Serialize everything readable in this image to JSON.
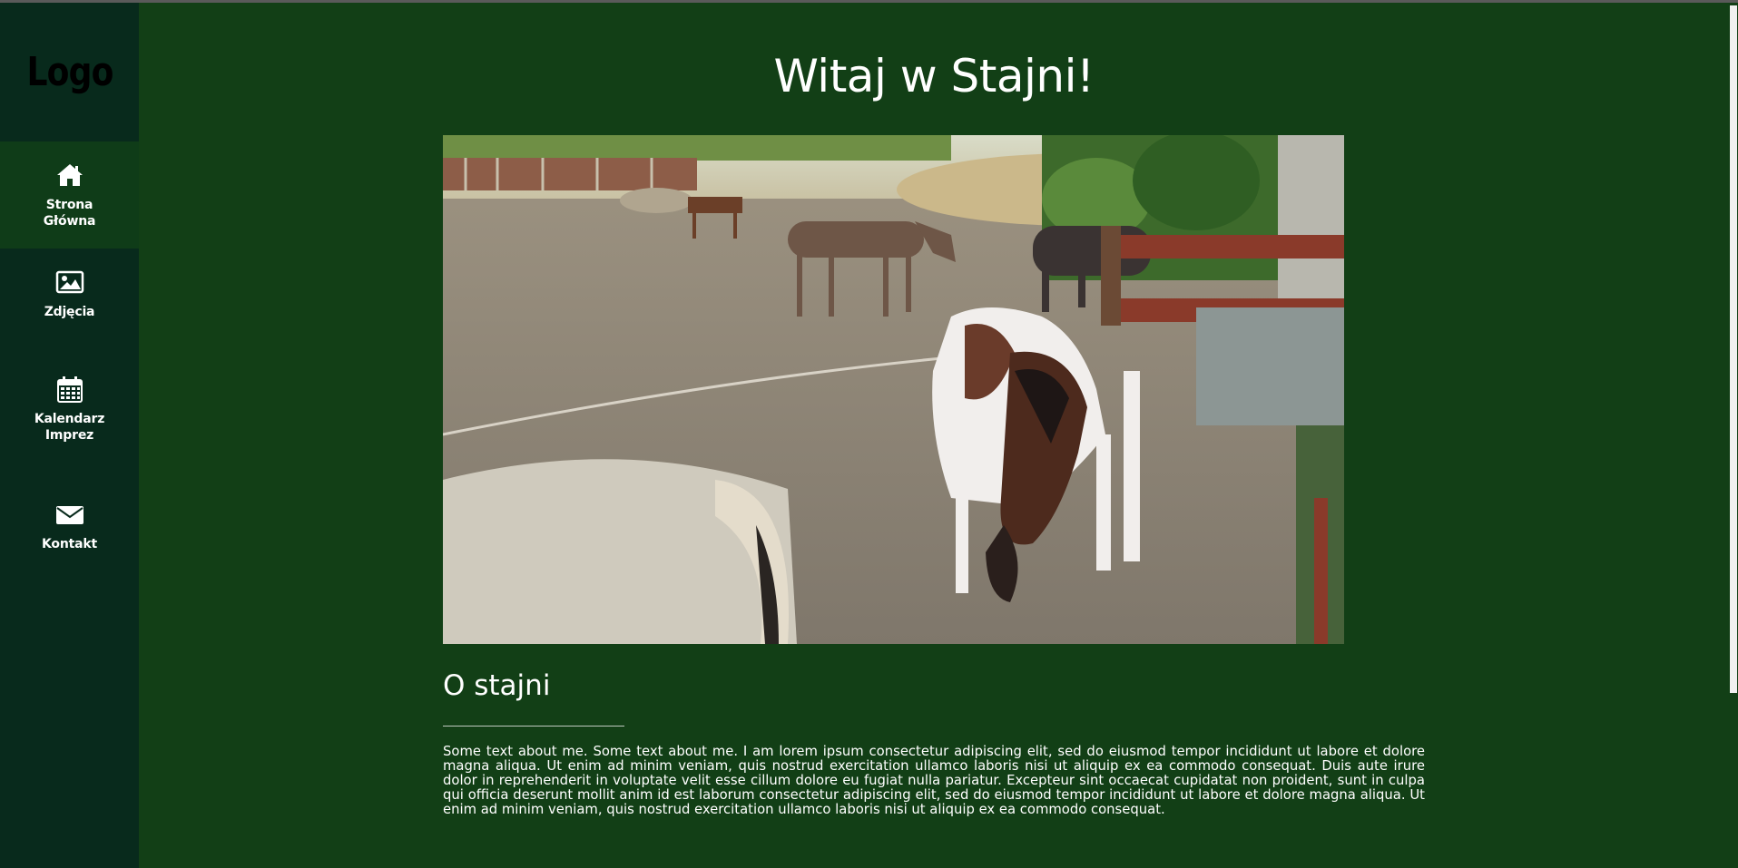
{
  "logo": {
    "text": "Logo"
  },
  "nav": {
    "items": [
      {
        "label": "Strona Główna",
        "icon": "home-icon",
        "active": true
      },
      {
        "label": "Zdjęcia",
        "icon": "image-icon",
        "active": false
      },
      {
        "label": "Kalendarz Imprez",
        "icon": "calendar-icon",
        "active": false
      },
      {
        "label": "Kontakt",
        "icon": "envelope-icon",
        "active": false
      }
    ]
  },
  "main": {
    "title": "Witaj w Stajni!",
    "hero_image": "horses-in-paddock-photo",
    "section_title": "O stajni",
    "about_text": "Some text about me. Some text about me. I am lorem ipsum consectetur adipiscing elit, sed do eiusmod tempor incididunt ut labore et dolore magna aliqua. Ut enim ad minim veniam, quis nostrud exercitation ullamco laboris nisi ut aliquip ex ea commodo consequat. Duis aute irure dolor in reprehenderit in voluptate velit esse cillum dolore eu fugiat nulla pariatur. Excepteur sint occaecat cupidatat non proident, sunt in culpa qui officia deserunt mollit anim id est laborum consectetur adipiscing elit, sed do eiusmod tempor incididunt ut labore et dolore magna aliqua. Ut enim ad minim veniam, quis nostrud exercitation ullamco laboris nisi ut aliquip ex ea commodo consequat."
  },
  "colors": {
    "page_background": "#123f16",
    "sidebar_background": "#082a1c",
    "active_nav_background": "#0f3c18",
    "text": "#ffffff"
  }
}
